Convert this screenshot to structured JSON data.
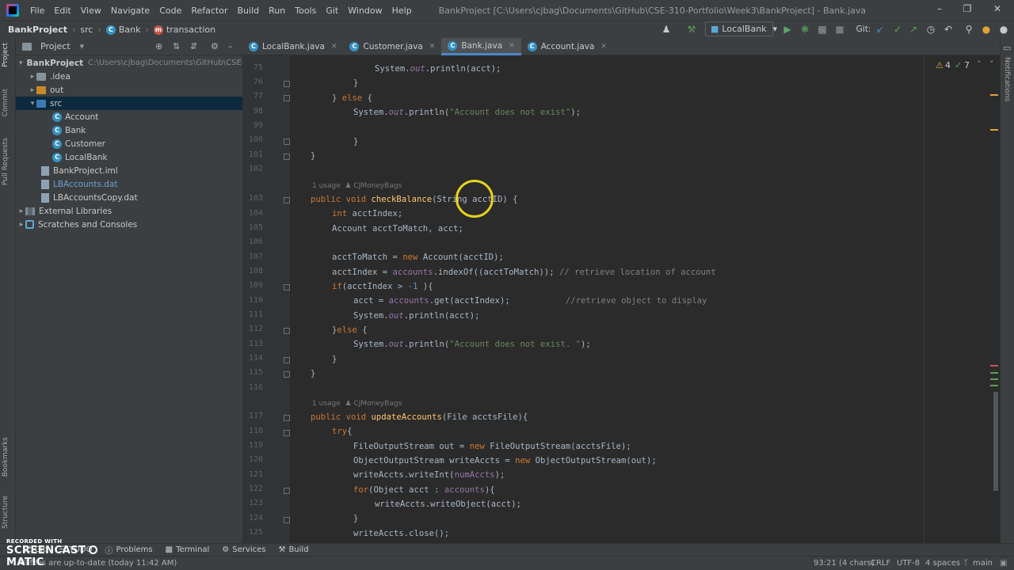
{
  "menubar": {
    "items": [
      "File",
      "Edit",
      "View",
      "Navigate",
      "Code",
      "Refactor",
      "Build",
      "Run",
      "Tools",
      "Git",
      "Window",
      "Help"
    ],
    "window_title": "BankProject [C:\\Users\\cjbag\\Documents\\GitHub\\CSE-310-Portfolio\\Week3\\BankProject] - Bank.java"
  },
  "breadcrumb": {
    "project": "BankProject",
    "folder": "src",
    "file": "Bank",
    "member": "transaction"
  },
  "toolbar": {
    "run_config": "LocalBank",
    "git_label": "Git:"
  },
  "project_panel": {
    "title": "Project",
    "root": "BankProject",
    "root_path": "C:\\Users\\cjbag\\Documents\\GitHub\\CSE-310",
    "items": [
      ".idea",
      "out",
      "src",
      "Account",
      "Bank",
      "Customer",
      "LocalBank",
      "BankProject.iml",
      "LBAccounts.dat",
      "LBAccountsCopy.dat",
      "External Libraries",
      "Scratches and Consoles"
    ]
  },
  "side_labels": {
    "project": "Project",
    "commit": "Commit",
    "pull_requests": "Pull Requests",
    "bookmarks": "Bookmarks",
    "structure": "Structure",
    "notifications": "Notifications"
  },
  "tabs": [
    "LocalBank.java",
    "Customer.java",
    "Bank.java",
    "Account.java"
  ],
  "inspections": {
    "warnings": "4",
    "ok": "7"
  },
  "editor": {
    "lines": [
      {
        "n": "75",
        "text": "System.out.println(acct);"
      },
      {
        "n": "76",
        "text": "}"
      },
      {
        "n": "77",
        "text": "} else {"
      },
      {
        "n": "98",
        "text": "System.out.println(\"Account does not exist\");"
      },
      {
        "n": "99",
        "text": ""
      },
      {
        "n": "100",
        "text": "}"
      },
      {
        "n": "101",
        "text": "}"
      },
      {
        "n": "102",
        "text": ""
      },
      {
        "n": "103",
        "text": "public void checkBalance(String acctID) {"
      },
      {
        "n": "104",
        "text": "int acctIndex;"
      },
      {
        "n": "105",
        "text": "Account acctToMatch, acct;"
      },
      {
        "n": "106",
        "text": ""
      },
      {
        "n": "107",
        "text": "acctToMatch = new Account(acctID);"
      },
      {
        "n": "108",
        "text": "acctIndex = accounts.indexOf((acctToMatch)); // retrieve location of account"
      },
      {
        "n": "109",
        "text": "if(acctIndex > -1 ){"
      },
      {
        "n": "110",
        "text": "acct = accounts.get(acctIndex);           //retrieve object to display"
      },
      {
        "n": "111",
        "text": "System.out.println(acct);"
      },
      {
        "n": "112",
        "text": "}else {"
      },
      {
        "n": "113",
        "text": "System.out.println(\"Account does not exist. \");"
      },
      {
        "n": "114",
        "text": "}"
      },
      {
        "n": "115",
        "text": "}"
      },
      {
        "n": "116",
        "text": ""
      },
      {
        "n": "117",
        "text": "public void updateAccounts(File acctsFile){"
      },
      {
        "n": "118",
        "text": "try{"
      },
      {
        "n": "119",
        "text": "FileOutputStream out = new FileOutputStream(acctsFile);"
      },
      {
        "n": "120",
        "text": "ObjectOutputStream writeAccts = new ObjectOutputStream(out);"
      },
      {
        "n": "121",
        "text": "writeAccts.writeInt(numAccts);"
      },
      {
        "n": "122",
        "text": "for(Object acct : accounts){"
      },
      {
        "n": "123",
        "text": "writeAccts.writeObject(acct);"
      },
      {
        "n": "124",
        "text": "}"
      },
      {
        "n": "125",
        "text": "writeAccts.close();"
      }
    ],
    "usage_label": "1 usage",
    "author": "CJMoneyBags"
  },
  "bottom_tabs": [
    "Git",
    "TODO",
    "Problems",
    "Terminal",
    "Services",
    "Build"
  ],
  "status": {
    "message": "All files are up-to-date (today 11:42 AM)",
    "position": "93:21 (4 chars)",
    "line_sep": "CRLF",
    "encoding": "UTF-8",
    "indent": "4 spaces",
    "branch": "main"
  },
  "watermark": {
    "line1": "RECORDED WITH",
    "line2": "SCREENCAST",
    "line3": "MATIC"
  }
}
